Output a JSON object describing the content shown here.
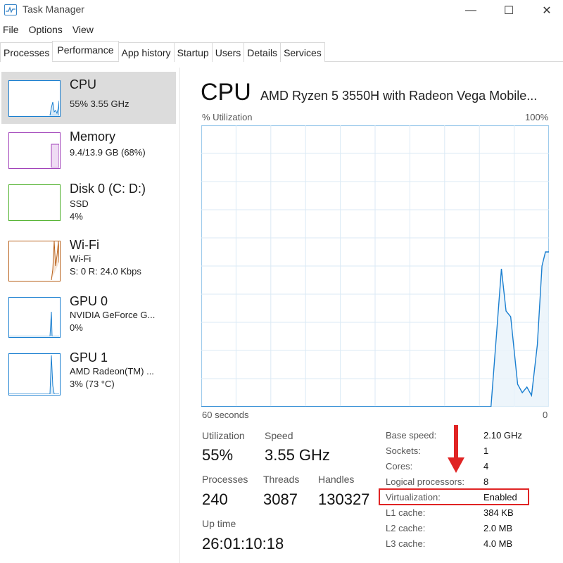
{
  "window": {
    "title": "Task Manager",
    "min_glyph": "—",
    "max_glyph": "☐",
    "close_glyph": "✕"
  },
  "menu": [
    "File",
    "Options",
    "View"
  ],
  "tabs": [
    {
      "label": "Processes",
      "active": false
    },
    {
      "label": "Performance",
      "active": true
    },
    {
      "label": "App history",
      "active": false
    },
    {
      "label": "Startup",
      "active": false
    },
    {
      "label": "Users",
      "active": false
    },
    {
      "label": "Details",
      "active": false
    },
    {
      "label": "Services",
      "active": false
    }
  ],
  "sidebar": {
    "items": [
      {
        "name": "CPU",
        "line1": "55%  3.55 GHz",
        "line2": "",
        "color": "#1a7fd0",
        "selected": true
      },
      {
        "name": "Memory",
        "line1": "9.4/13.9 GB (68%)",
        "line2": "",
        "color": "#a040b8",
        "selected": false
      },
      {
        "name": "Disk 0 (C: D:)",
        "line1": "SSD",
        "line2": "4%",
        "color": "#4caf28",
        "selected": false
      },
      {
        "name": "Wi-Fi",
        "line1": "Wi-Fi",
        "line2": "S: 0  R: 24.0 Kbps",
        "color": "#b8601a",
        "selected": false
      },
      {
        "name": "GPU 0",
        "line1": "NVIDIA GeForce G...",
        "line2": "0%",
        "color": "#1a7fd0",
        "selected": false
      },
      {
        "name": "GPU 1",
        "line1": "AMD Radeon(TM) ...",
        "line2": "3%  (73 °C)",
        "color": "#1a7fd0",
        "selected": false
      }
    ]
  },
  "main": {
    "title": "CPU",
    "processor": "AMD Ryzen 5 3550H with Radeon Vega Mobile...",
    "y_label": "% Utilization",
    "y_max": "100%",
    "x_left": "60 seconds",
    "x_right": "0"
  },
  "chart_data": {
    "type": "area",
    "title": "",
    "xlabel": "60 seconds",
    "ylabel": "% Utilization",
    "x_range": [
      60,
      0
    ],
    "ylim": [
      0,
      100
    ],
    "grid": true,
    "x": [
      60,
      10.0,
      9.0,
      8.2,
      7.4,
      6.6,
      5.4,
      4.6,
      3.8,
      3.0,
      2.0,
      1.2,
      0.6,
      0
    ],
    "values": [
      0,
      0,
      27,
      49,
      34,
      32,
      8,
      5,
      7,
      4,
      22,
      50,
      55,
      55
    ],
    "color": "#1a7fd0"
  },
  "stats": {
    "utilization_label": "Utilization",
    "utilization_value": "55%",
    "speed_label": "Speed",
    "speed_value": "3.55 GHz",
    "processes_label": "Processes",
    "processes_value": "240",
    "threads_label": "Threads",
    "threads_value": "3087",
    "handles_label": "Handles",
    "handles_value": "130327",
    "uptime_label": "Up time",
    "uptime_value": "26:01:10:18"
  },
  "specs": [
    {
      "label": "Base speed:",
      "value": "2.10 GHz"
    },
    {
      "label": "Sockets:",
      "value": "1"
    },
    {
      "label": "Cores:",
      "value": "4"
    },
    {
      "label": "Logical processors:",
      "value": "8"
    },
    {
      "label": "Virtualization:",
      "value": "Enabled"
    },
    {
      "label": "L1 cache:",
      "value": "384 KB"
    },
    {
      "label": "L2 cache:",
      "value": "2.0 MB"
    },
    {
      "label": "L3 cache:",
      "value": "4.0 MB"
    }
  ],
  "annotation": {
    "color": "#e02424"
  }
}
